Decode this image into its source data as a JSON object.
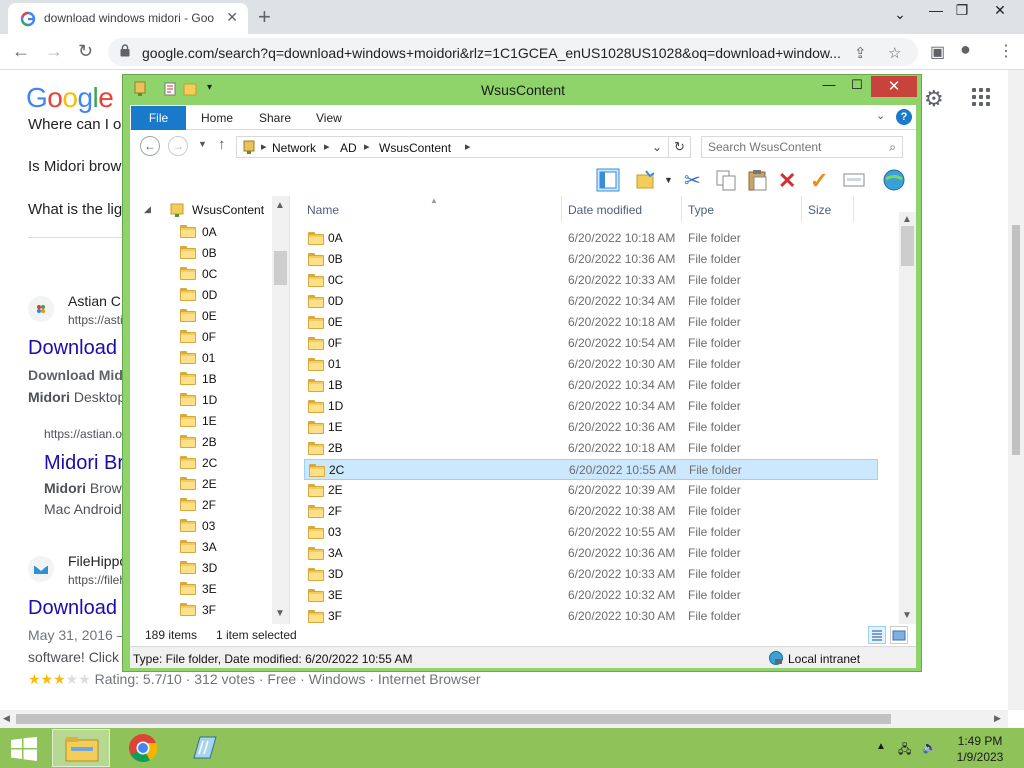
{
  "browser": {
    "tab_title": "download windows midori - Goo",
    "url": "google.com/search?q=download+windows+moidori&rlz=1C1GCEA_enUS1028US1028&oq=download+window..."
  },
  "google": {
    "logo": [
      "G",
      "o",
      "o",
      "g",
      "l",
      "e"
    ],
    "paa": [
      "Where can I o",
      "Is Midori brow",
      "What is the lig"
    ],
    "result1": {
      "source": "Astian C",
      "cite": "https://astia",
      "title": "Download",
      "snippet1_bold": "Download Mid",
      "snippet2_bold": "Midori",
      "snippet2": " Desktop"
    },
    "sub1": {
      "cite": "https://astian.o",
      "title": "Midori Br",
      "snippet1_bold": "Midori",
      "snippet1": " Brow",
      "snippet2": "Mac Android"
    },
    "result2": {
      "source": "FileHippo",
      "cite": "https://fileh",
      "title": "Download",
      "snippet1": "May 31, 2016 –",
      "snippet2": "software! Click",
      "rating": "Rating: 5.7/10 · 312 votes · Free · Windows · Internet Browser",
      "stars_filled": 3,
      "stars_total": 5
    }
  },
  "explorer": {
    "title": "WsusContent",
    "ribbon_tabs": [
      "File",
      "Home",
      "Share",
      "View"
    ],
    "help": "?",
    "breadcrumb": [
      "Network",
      "AD",
      "WsusContent"
    ],
    "search_placeholder": "Search WsusContent",
    "tree_root": "WsusContent",
    "tree": [
      "0A",
      "0B",
      "0C",
      "0D",
      "0E",
      "0F",
      "01",
      "1B",
      "1D",
      "1E",
      "2B",
      "2C",
      "2E",
      "2F",
      "03",
      "3A",
      "3D",
      "3E",
      "3F"
    ],
    "columns": [
      "Name",
      "Date modified",
      "Type",
      "Size"
    ],
    "files": [
      {
        "name": "0A",
        "date": "6/20/2022 10:18 AM",
        "type": "File folder"
      },
      {
        "name": "0B",
        "date": "6/20/2022 10:36 AM",
        "type": "File folder"
      },
      {
        "name": "0C",
        "date": "6/20/2022 10:33 AM",
        "type": "File folder"
      },
      {
        "name": "0D",
        "date": "6/20/2022 10:34 AM",
        "type": "File folder"
      },
      {
        "name": "0E",
        "date": "6/20/2022 10:18 AM",
        "type": "File folder"
      },
      {
        "name": "0F",
        "date": "6/20/2022 10:54 AM",
        "type": "File folder"
      },
      {
        "name": "01",
        "date": "6/20/2022 10:30 AM",
        "type": "File folder"
      },
      {
        "name": "1B",
        "date": "6/20/2022 10:34 AM",
        "type": "File folder"
      },
      {
        "name": "1D",
        "date": "6/20/2022 10:34 AM",
        "type": "File folder"
      },
      {
        "name": "1E",
        "date": "6/20/2022 10:36 AM",
        "type": "File folder"
      },
      {
        "name": "2B",
        "date": "6/20/2022 10:18 AM",
        "type": "File folder"
      },
      {
        "name": "2C",
        "date": "6/20/2022 10:55 AM",
        "type": "File folder",
        "selected": true
      },
      {
        "name": "2E",
        "date": "6/20/2022 10:39 AM",
        "type": "File folder"
      },
      {
        "name": "2F",
        "date": "6/20/2022 10:38 AM",
        "type": "File folder"
      },
      {
        "name": "03",
        "date": "6/20/2022 10:55 AM",
        "type": "File folder"
      },
      {
        "name": "3A",
        "date": "6/20/2022 10:36 AM",
        "type": "File folder"
      },
      {
        "name": "3D",
        "date": "6/20/2022 10:33 AM",
        "type": "File folder"
      },
      {
        "name": "3E",
        "date": "6/20/2022 10:32 AM",
        "type": "File folder"
      },
      {
        "name": "3F",
        "date": "6/20/2022 10:30 AM",
        "type": "File folder"
      }
    ],
    "item_count": "189 items",
    "selection": "1 item selected",
    "details": "Type: File folder, Date modified: 6/20/2022 10:55 AM",
    "zone": "Local intranet"
  },
  "taskbar": {
    "time": "1:49 PM",
    "date": "1/9/2023"
  },
  "colors": {
    "window_frame": "#8ed46a",
    "taskbar": "#8fc35a",
    "selection": "#cce8ff",
    "link": "#1a0dab"
  }
}
